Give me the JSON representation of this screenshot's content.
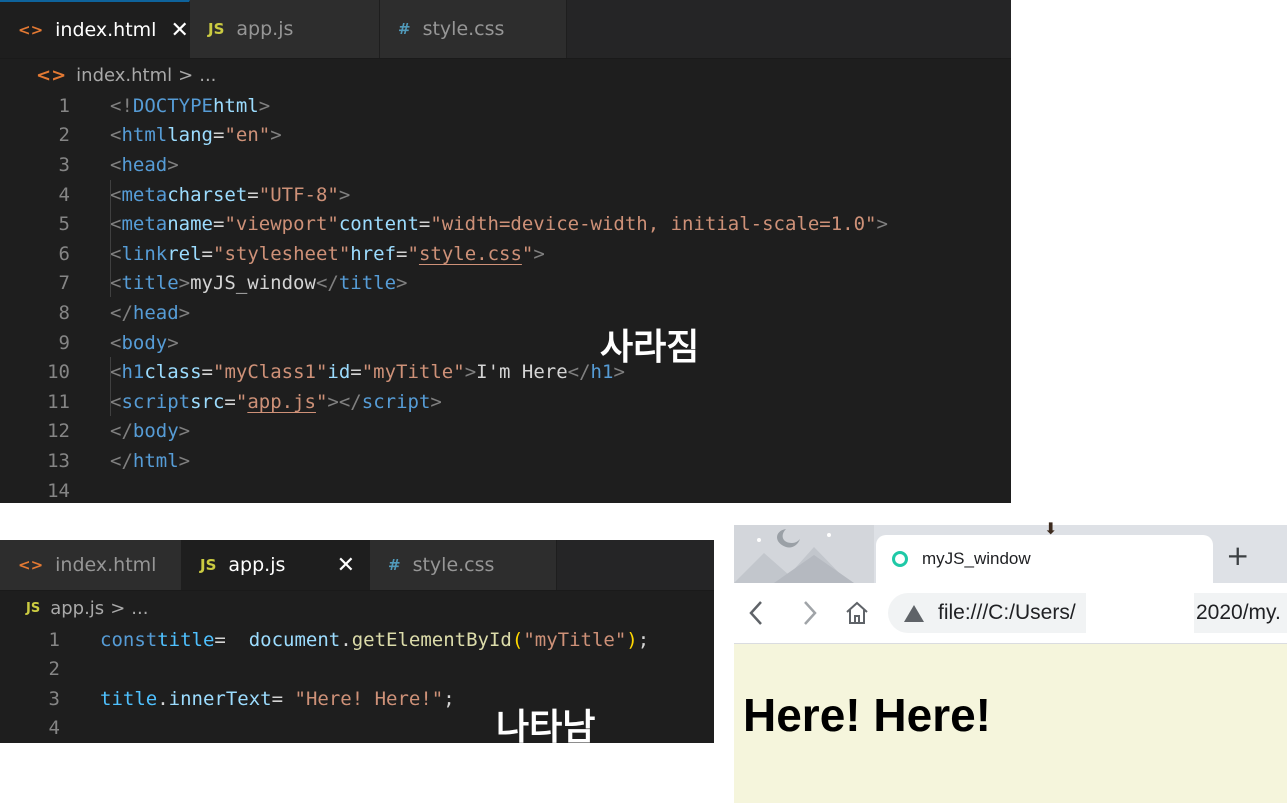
{
  "top_editor": {
    "tabs": [
      {
        "icon": "<>",
        "label": "index.html",
        "close": "✕"
      },
      {
        "icon": "JS",
        "label": "app.js"
      },
      {
        "icon": "#",
        "label": "style.css"
      }
    ],
    "breadcrumb": {
      "icon": "<>",
      "file": "index.html",
      "sep": ">",
      "more": "..."
    },
    "line_numbers": [
      "1",
      "2",
      "3",
      "4",
      "5",
      "6",
      "7",
      "8",
      "9",
      "10",
      "11",
      "12",
      "13",
      "14"
    ]
  },
  "bottom_editor": {
    "tabs": [
      {
        "icon": "<>",
        "label": "index.html"
      },
      {
        "icon": "JS",
        "label": "app.js",
        "close": "✕"
      },
      {
        "icon": "#",
        "label": "style.css"
      }
    ],
    "breadcrumb": {
      "icon": "JS",
      "file": "app.js",
      "sep": ">",
      "more": "..."
    },
    "line_numbers": [
      "1",
      "2",
      "3",
      "4"
    ]
  },
  "annotations": {
    "disappears": "사라짐",
    "appears": "나타남"
  },
  "browser": {
    "tab_title": "myJS_window",
    "new_tab": "+",
    "url_start": "file:///C:/Users/",
    "url_end": "2020/my.",
    "page_heading": "Here! Here!"
  },
  "colors": {
    "editor_bg": "#1e1e1e",
    "tab_bar": "#252526",
    "page_bg": "#f5f5dc",
    "loader": "#1fc9a7"
  }
}
